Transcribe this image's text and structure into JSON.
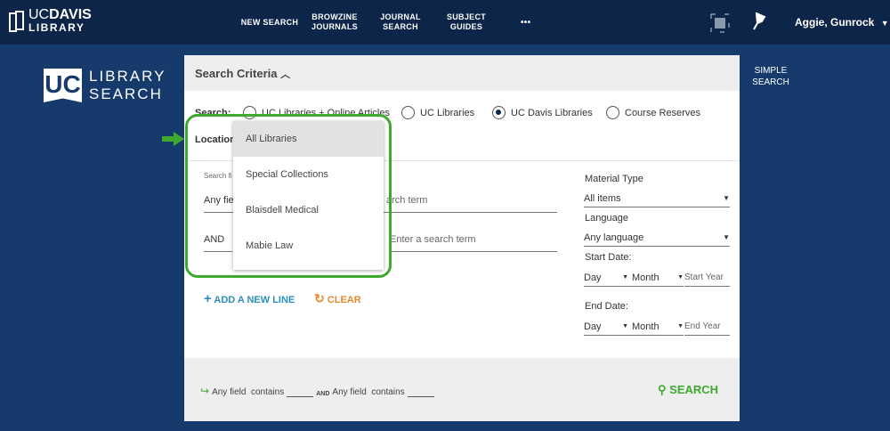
{
  "header": {
    "logo_line1_light": "UC",
    "logo_line1_bold": "DAVIS",
    "logo_line2": "LIBRARY",
    "nav": [
      "NEW SEARCH",
      "BROWZINE JOURNALS",
      "JOURNAL SEARCH",
      "SUBJECT GUIDES"
    ],
    "more": "•••",
    "user": "Aggie, Gunrock"
  },
  "brand": {
    "badge": "UC",
    "line1": "LIBRARY",
    "line2": "SEARCH"
  },
  "simple_search": "SIMPLE SEARCH",
  "panel": {
    "title": "Search Criteria",
    "search_label": "Search:",
    "scopes": [
      {
        "label": "UC Libraries + Online Articles",
        "selected": false
      },
      {
        "label": "UC Libraries",
        "selected": false
      },
      {
        "label": "UC Davis Libraries",
        "selected": true
      },
      {
        "label": "Course Reserves",
        "selected": false
      }
    ],
    "location_label": "Location:",
    "location_options": [
      "All Libraries",
      "Special Collections",
      "Blaisdell Medical",
      "Mabie Law"
    ],
    "search_fields_label": "Search fi",
    "row1_field": "Any fie",
    "row1_placeholder": "arch term",
    "row2_op": "AND",
    "row2_placeholder": "Enter a search term",
    "add_line": "ADD A NEW LINE",
    "clear": "CLEAR",
    "material_type_label": "Material Type",
    "material_type_value": "All items",
    "language_label": "Language",
    "language_value": "Any language",
    "start_date_label": "Start Date:",
    "end_date_label": "End Date:",
    "day": "Day",
    "month": "Month",
    "start_year": "Start Year",
    "end_year": "End Year",
    "summary": {
      "part1": "Any field  contains",
      "op": "AND",
      "part2": "Any field  contains"
    },
    "search_button": "SEARCH"
  },
  "colors": {
    "header": "#0c2548",
    "background": "#153a6b",
    "highlight": "#3daa2e",
    "link": "#2a8fbd",
    "clear": "#e8892b"
  }
}
